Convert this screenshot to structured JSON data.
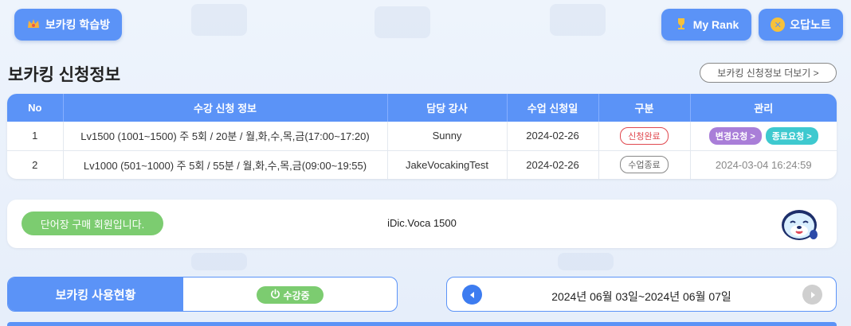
{
  "header": {
    "study_room_label": "보카킹 학습방",
    "my_rank_label": "My Rank",
    "wrong_note_label": "오답노트"
  },
  "section": {
    "title": "보카킹 신청정보",
    "more_label": "보카킹 신청정보 더보기 >"
  },
  "table": {
    "headers": [
      "No",
      "수강 신청 정보",
      "담당 강사",
      "수업 신청일",
      "구분",
      "관리"
    ],
    "rows": [
      {
        "no": "1",
        "info": "Lv1500 (1001~1500) 주 5회 / 20분 / 월,화,수,목,금(17:00~17:20)",
        "teacher": "Sunny",
        "date": "2024-02-26",
        "status": "신청완료",
        "action_change": "변경요청 >",
        "action_end": "종료요청 >"
      },
      {
        "no": "2",
        "info": "Lv1000 (501~1000) 주 5회 / 55분 / 월,화,수,목,금(09:00~19:55)",
        "teacher": "JakeVocakingTest",
        "date": "2024-02-26",
        "status": "수업종료",
        "ended_at": "2024-03-04 16:24:59"
      }
    ]
  },
  "member": {
    "badge": "단어장 구매 회원입니다.",
    "voca_name": "iDic.Voca 1500"
  },
  "usage": {
    "label": "보카킹 사용현황",
    "status": "수강중"
  },
  "date_range": {
    "text": "2024년 06월 03일~2024년 06월 07일"
  },
  "colors": {
    "primary": "#5b93f7",
    "green": "#7ccc70",
    "red": "#e0484f",
    "purple": "#a97ed8",
    "teal": "#3ec9cf"
  }
}
